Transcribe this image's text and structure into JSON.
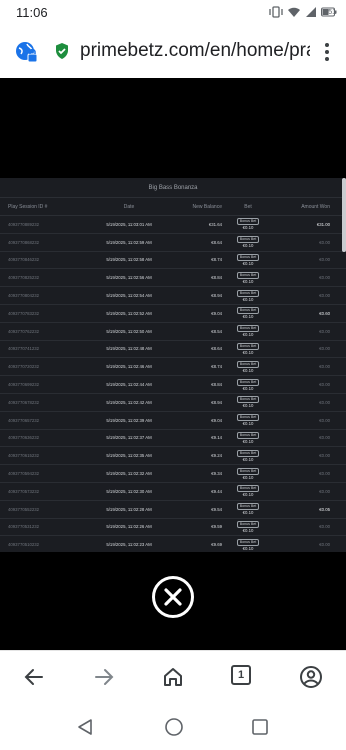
{
  "status_bar": {
    "time": "11:06",
    "battery": "51"
  },
  "browser": {
    "url": "primebetz.com/en/home/prag",
    "tab_count": "1"
  },
  "game": {
    "title": "Big Bass Bonanza",
    "columns": [
      "Play Session ID #",
      "Date",
      "New Balance",
      "Bet",
      "Amount Won"
    ],
    "rows": [
      {
        "id": "4093770889232",
        "date": "5/19/2025, 11:03:01 AM",
        "balance": "€31.64",
        "bonus": "Bonus Bet",
        "bet": "€0.10",
        "won": "€31.00"
      },
      {
        "id": "4093770868232",
        "date": "5/19/2025, 11:02:59 AM",
        "balance": "€8.64",
        "bonus": "Bonus Bet",
        "bet": "€0.10",
        "won": "€0.00"
      },
      {
        "id": "4093770846232",
        "date": "5/19/2025, 11:02:58 AM",
        "balance": "€8.74",
        "bonus": "Bonus Bet",
        "bet": "€0.10",
        "won": "€0.00"
      },
      {
        "id": "4093770825232",
        "date": "5/19/2025, 11:02:56 AM",
        "balance": "€8.84",
        "bonus": "Bonus Bet",
        "bet": "€0.10",
        "won": "€0.00"
      },
      {
        "id": "4093770804232",
        "date": "5/19/2025, 11:02:54 AM",
        "balance": "€8.94",
        "bonus": "Bonus Bet",
        "bet": "€0.10",
        "won": "€0.00"
      },
      {
        "id": "4093770783232",
        "date": "5/19/2025, 11:02:52 AM",
        "balance": "€9.04",
        "bonus": "Bonus Bet",
        "bet": "€0.10",
        "won": "€0.60"
      },
      {
        "id": "4093770762232",
        "date": "5/19/2025, 11:02:50 AM",
        "balance": "€8.54",
        "bonus": "Bonus Bet",
        "bet": "€0.10",
        "won": "€0.00"
      },
      {
        "id": "4093770741232",
        "date": "5/19/2025, 11:02:48 AM",
        "balance": "€8.64",
        "bonus": "Bonus Bet",
        "bet": "€0.10",
        "won": "€0.00"
      },
      {
        "id": "4093770720232",
        "date": "5/19/2025, 11:02:46 AM",
        "balance": "€8.74",
        "bonus": "Bonus Bet",
        "bet": "€0.10",
        "won": "€0.00"
      },
      {
        "id": "4093770699232",
        "date": "5/19/2025, 11:02:44 AM",
        "balance": "€8.84",
        "bonus": "Bonus Bet",
        "bet": "€0.10",
        "won": "€0.00"
      },
      {
        "id": "4093770678232",
        "date": "5/19/2025, 11:02:42 AM",
        "balance": "€8.94",
        "bonus": "Bonus Bet",
        "bet": "€0.10",
        "won": "€0.00"
      },
      {
        "id": "4093770657232",
        "date": "5/19/2025, 11:02:39 AM",
        "balance": "€9.04",
        "bonus": "Bonus Bet",
        "bet": "€0.10",
        "won": "€0.00"
      },
      {
        "id": "4093770636232",
        "date": "5/19/2025, 11:02:37 AM",
        "balance": "€9.14",
        "bonus": "Bonus Bet",
        "bet": "€0.10",
        "won": "€0.00"
      },
      {
        "id": "4093770615232",
        "date": "5/19/2025, 11:02:35 AM",
        "balance": "€9.24",
        "bonus": "Bonus Bet",
        "bet": "€0.10",
        "won": "€0.00"
      },
      {
        "id": "4093770594232",
        "date": "5/19/2025, 11:02:32 AM",
        "balance": "€9.34",
        "bonus": "Bonus Bet",
        "bet": "€0.10",
        "won": "€0.00"
      },
      {
        "id": "4093770573232",
        "date": "5/19/2025, 11:02:30 AM",
        "balance": "€9.44",
        "bonus": "Bonus Bet",
        "bet": "€0.10",
        "won": "€0.00"
      },
      {
        "id": "4093770552232",
        "date": "5/19/2025, 11:02:28 AM",
        "balance": "€9.54",
        "bonus": "Bonus Bet",
        "bet": "€0.10",
        "won": "€0.05"
      },
      {
        "id": "4093770531232",
        "date": "5/19/2025, 11:02:26 AM",
        "balance": "€9.59",
        "bonus": "Bonus Bet",
        "bet": "€0.10",
        "won": "€0.00"
      },
      {
        "id": "4093770510232",
        "date": "5/19/2025, 11:02:23 AM",
        "balance": "€9.69",
        "bonus": "Bonus Bet",
        "bet": "€0.10",
        "won": "€0.00"
      }
    ]
  },
  "colors": {
    "panel_bg": "#1b1d22",
    "accent_green": "#1e8e3e",
    "site_icon_blue": "#1a73e8"
  },
  "icons": {
    "site": "globe-lock-icon",
    "secure": "shield-check-icon",
    "menu": "more-vert-icon",
    "close": "close-circle-icon",
    "back": "arrow-back-icon",
    "forward": "arrow-forward-icon",
    "home": "home-icon",
    "account": "account-circle-icon"
  }
}
